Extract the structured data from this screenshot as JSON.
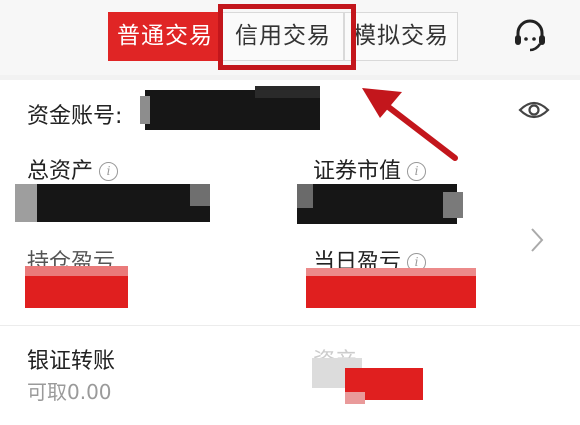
{
  "tabs": {
    "normal": "普通交易",
    "credit": "信用交易",
    "simulated": "模拟交易"
  },
  "account": {
    "label": "资金账号:"
  },
  "assets": {
    "total_label": "总资产",
    "market_value_label": "证券市值",
    "hold_pnl_label": "持仓盈亏",
    "daily_pnl_label": "当日盈亏"
  },
  "transfer": {
    "label": "银证转账",
    "available": "可取0.00",
    "asset_label": "资产"
  },
  "colors": {
    "accent": "#e02525",
    "annotation": "#c3161c"
  },
  "icons": {
    "service": "customer-service-icon",
    "eye": "eye-icon",
    "chevron": "chevron-right-icon",
    "info": "info-icon"
  }
}
